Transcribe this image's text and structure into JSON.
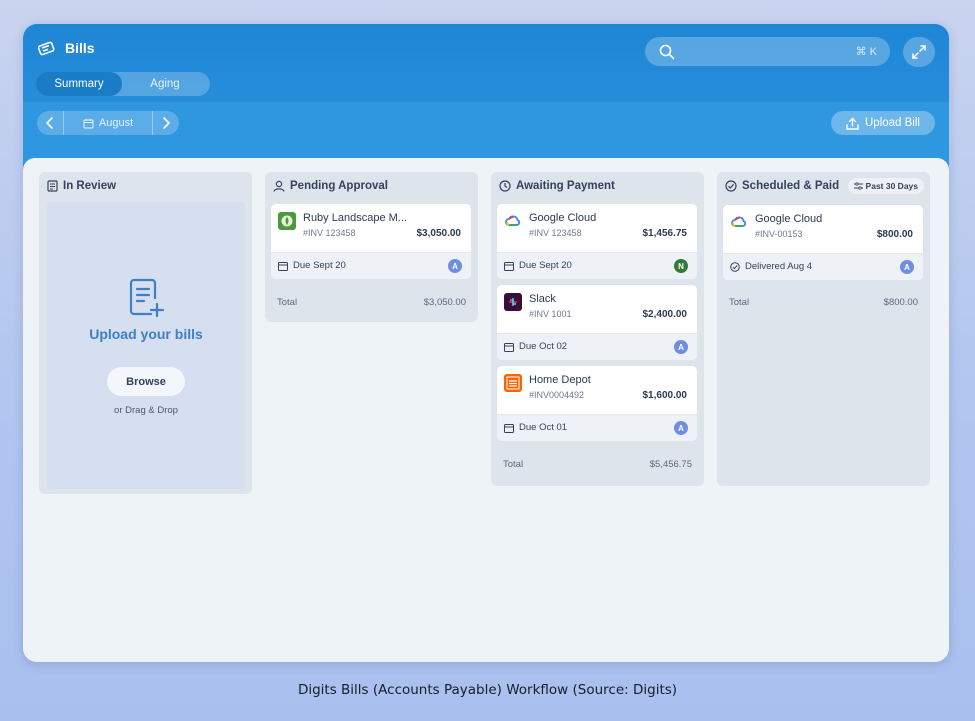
{
  "app": {
    "title": "Bills"
  },
  "tabs": [
    {
      "label": "Summary",
      "active": true
    },
    {
      "label": "Aging",
      "active": false
    }
  ],
  "search": {
    "shortcut": "⌘ K",
    "placeholder": ""
  },
  "toolbar": {
    "month": "August",
    "upload_label": "Upload Bill"
  },
  "columns": {
    "in_review": {
      "title": "In Review",
      "upload_title": "Upload your bills",
      "browse_label": "Browse",
      "drag_text": "or Drag & Drop"
    },
    "pending": {
      "title": "Pending Approval",
      "cards": [
        {
          "vendor": "Ruby Landscape M...",
          "invoice": "#INV 123458",
          "amount": "$3,050.00",
          "due": "Due Sept 20",
          "avatar": "A"
        }
      ],
      "total_label": "Total",
      "total": "$3,050.00"
    },
    "awaiting": {
      "title": "Awaiting Payment",
      "cards": [
        {
          "vendor": "Google Cloud",
          "invoice": "#INV 123458",
          "amount": "$1,456.75",
          "due": "Due Sept 20",
          "avatar": "N"
        },
        {
          "vendor": "Slack",
          "invoice": "#INV 1001",
          "amount": "$2,400.00",
          "due": "Due Oct 02",
          "avatar": "A"
        },
        {
          "vendor": "Home Depot",
          "invoice": "#INV0004492",
          "amount": "$1,600.00",
          "due": "Due Oct 01",
          "avatar": "A"
        }
      ],
      "total_label": "Total",
      "total": "$5,456.75"
    },
    "scheduled": {
      "title": "Scheduled & Paid",
      "range": "Past 30 Days",
      "cards": [
        {
          "vendor": "Google Cloud",
          "invoice": "#INV-00153",
          "amount": "$800.00",
          "status": "Delivered Aug 4",
          "avatar": "A"
        }
      ],
      "total_label": "Total",
      "total": "$800.00"
    }
  },
  "caption": "Digits Bills (Accounts Payable) Workflow (Source: Digits)",
  "colors": {
    "header_blue": "#1f86d6",
    "avatar_blue": "#6e8fe0",
    "avatar_green": "#2f7a3a",
    "upload_text": "#3f7fc4"
  }
}
